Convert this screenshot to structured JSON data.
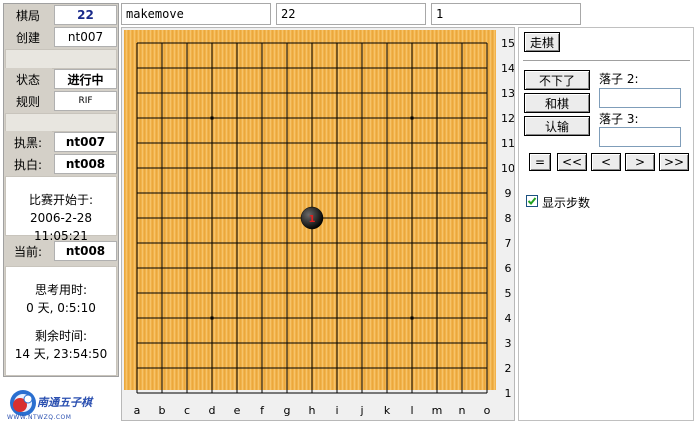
{
  "info": {
    "game_label": "棋局",
    "game_value": "22",
    "creator_label": "创建",
    "creator_value": "nt007",
    "status_label": "状态",
    "status_value": "进行中",
    "rule_label": "规则",
    "rule_value": "RIF",
    "black_label": "执黑:",
    "black_value": "nt007",
    "white_label": "执白:",
    "white_value": "nt008",
    "start_label": "比赛开始于:",
    "start_value": "2006-2-28 11:05:21",
    "current_label": "当前:",
    "current_value": "nt008",
    "think_label": "思考用时:",
    "think_value": "0 天, 0:5:10",
    "remain_label": "剩余时间:",
    "remain_value": "14 天, 23:54:50"
  },
  "topbar": {
    "command": "makemove",
    "game_id": "22",
    "move_no": "1"
  },
  "board": {
    "columns": [
      "a",
      "b",
      "c",
      "d",
      "e",
      "f",
      "g",
      "h",
      "i",
      "j",
      "k",
      "l",
      "m",
      "n",
      "o"
    ],
    "rows": [
      "15",
      "14",
      "13",
      "12",
      "11",
      "10",
      "9",
      "8",
      "7",
      "6",
      "5",
      "4",
      "3",
      "2",
      "1"
    ],
    "star_points": [
      "d12",
      "l12",
      "h8",
      "d4",
      "l4"
    ],
    "stones": [
      {
        "color": "black",
        "pos": "h8",
        "number": "1"
      }
    ],
    "board_color": "#f2b24c",
    "line_color": "#000000"
  },
  "controls": {
    "move_button": "走棋",
    "resign_button": "不下了",
    "draw_button": "和棋",
    "surrender_button": "认输",
    "place2_label": "落子 2:",
    "place3_label": "落子 3:",
    "nav": [
      "=",
      "<<",
      "<",
      ">",
      ">>"
    ],
    "show_steps_label": "显示步数",
    "show_steps_checked": true
  },
  "logo": {
    "text": "南通五子棋",
    "sub": "WWW.NTWZQ.COM"
  }
}
